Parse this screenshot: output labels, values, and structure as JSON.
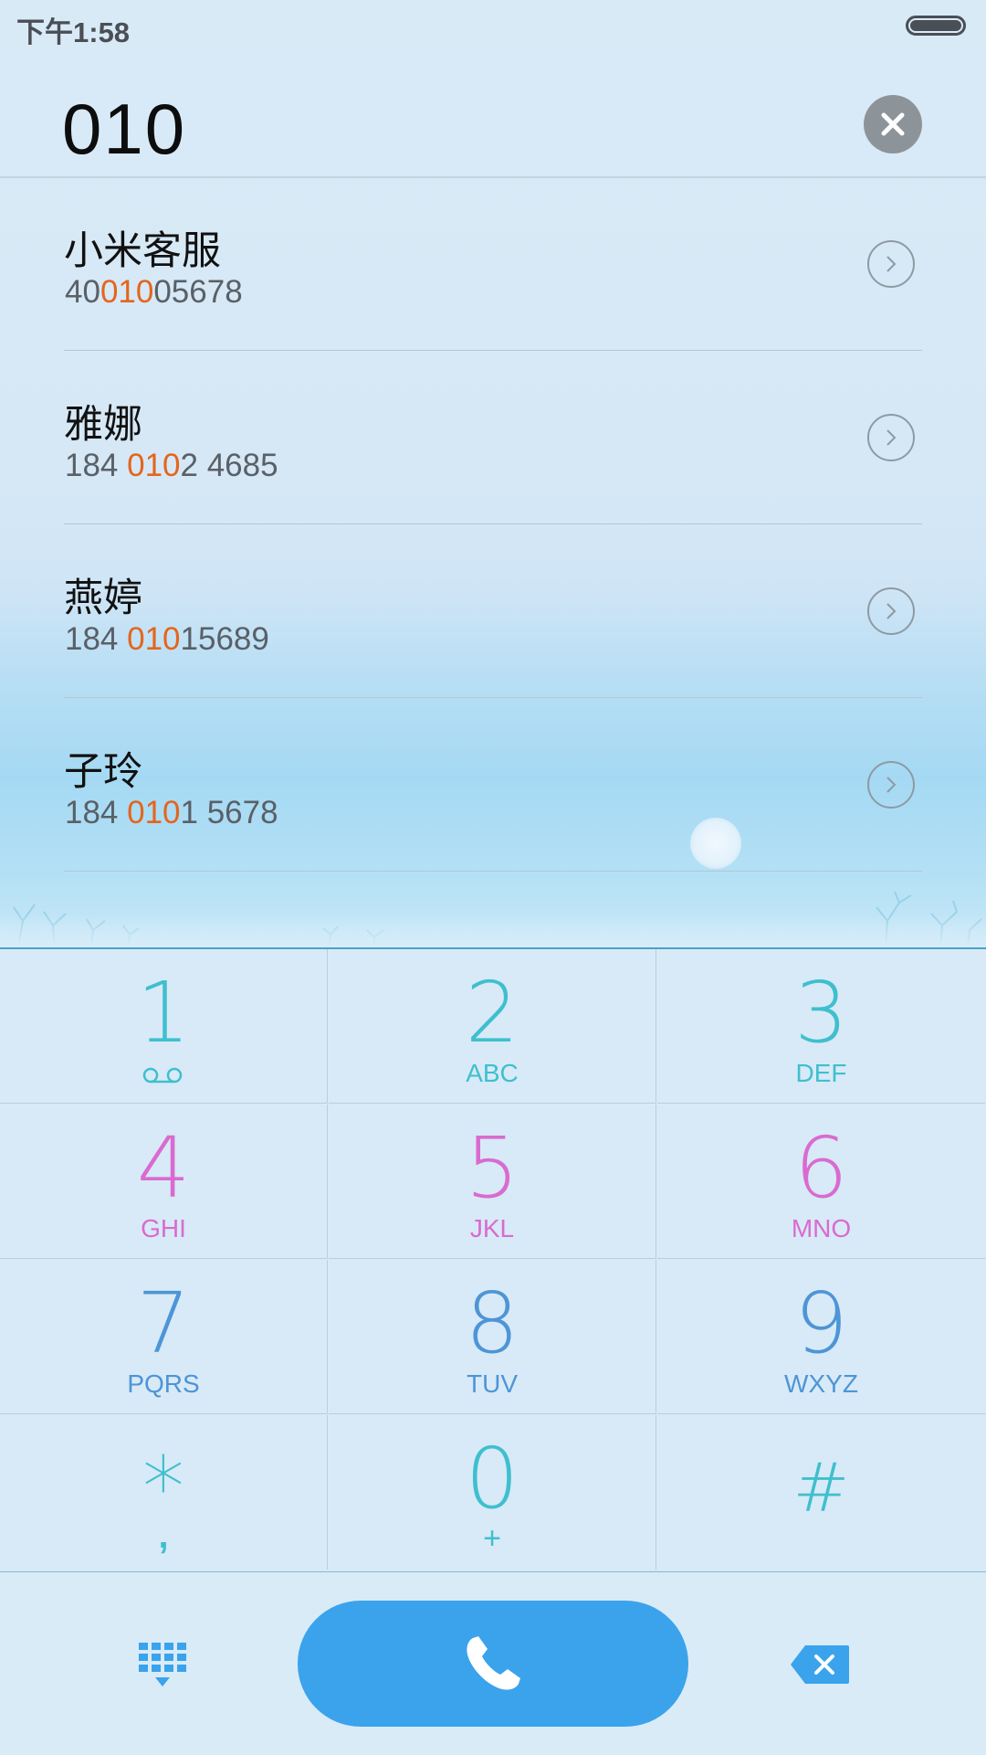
{
  "status_bar": {
    "time": "下午1:58"
  },
  "dialer": {
    "input_digits": "010"
  },
  "contacts": [
    {
      "name": "小米客服",
      "number_before": "40",
      "number_match": "010",
      "number_after": "05678"
    },
    {
      "name": "雅娜",
      "number_before": "184 ",
      "number_match": "010",
      "number_after": "2 4685"
    },
    {
      "name": "燕婷",
      "number_before": "184 ",
      "number_match": "010",
      "number_after": "15689"
    },
    {
      "name": "子玲",
      "number_before": "184 ",
      "number_match": "010",
      "number_after": "1 5678"
    }
  ],
  "keypad": [
    {
      "digit": "1",
      "sub": "",
      "icon": "voicemail-icon",
      "color": "cyan"
    },
    {
      "digit": "2",
      "sub": "ABC",
      "color": "cyan"
    },
    {
      "digit": "3",
      "sub": "DEF",
      "color": "cyan"
    },
    {
      "digit": "4",
      "sub": "GHI",
      "color": "pink"
    },
    {
      "digit": "5",
      "sub": "JKL",
      "color": "pink"
    },
    {
      "digit": "6",
      "sub": "MNO",
      "color": "pink"
    },
    {
      "digit": "7",
      "sub": "PQRS",
      "color": "blue"
    },
    {
      "digit": "8",
      "sub": "TUV",
      "color": "blue"
    },
    {
      "digit": "9",
      "sub": "WXYZ",
      "color": "blue"
    },
    {
      "digit": "*",
      "sub": ",",
      "color": "cyan"
    },
    {
      "digit": "0",
      "sub": "+",
      "color": "cyan"
    },
    {
      "digit": "#",
      "sub": "",
      "color": "cyan"
    }
  ],
  "colors": {
    "match_highlight": "#e4651d",
    "call_button": "#3aa3ec",
    "cyan": "#3fbfce",
    "pink": "#d96bd0",
    "blue": "#4d95d6"
  },
  "icons": {
    "clear": "close-icon",
    "contact_detail": "chevron-right-icon",
    "call": "phone-icon",
    "keypad_toggle": "keypad-icon",
    "backspace": "backspace-icon"
  }
}
